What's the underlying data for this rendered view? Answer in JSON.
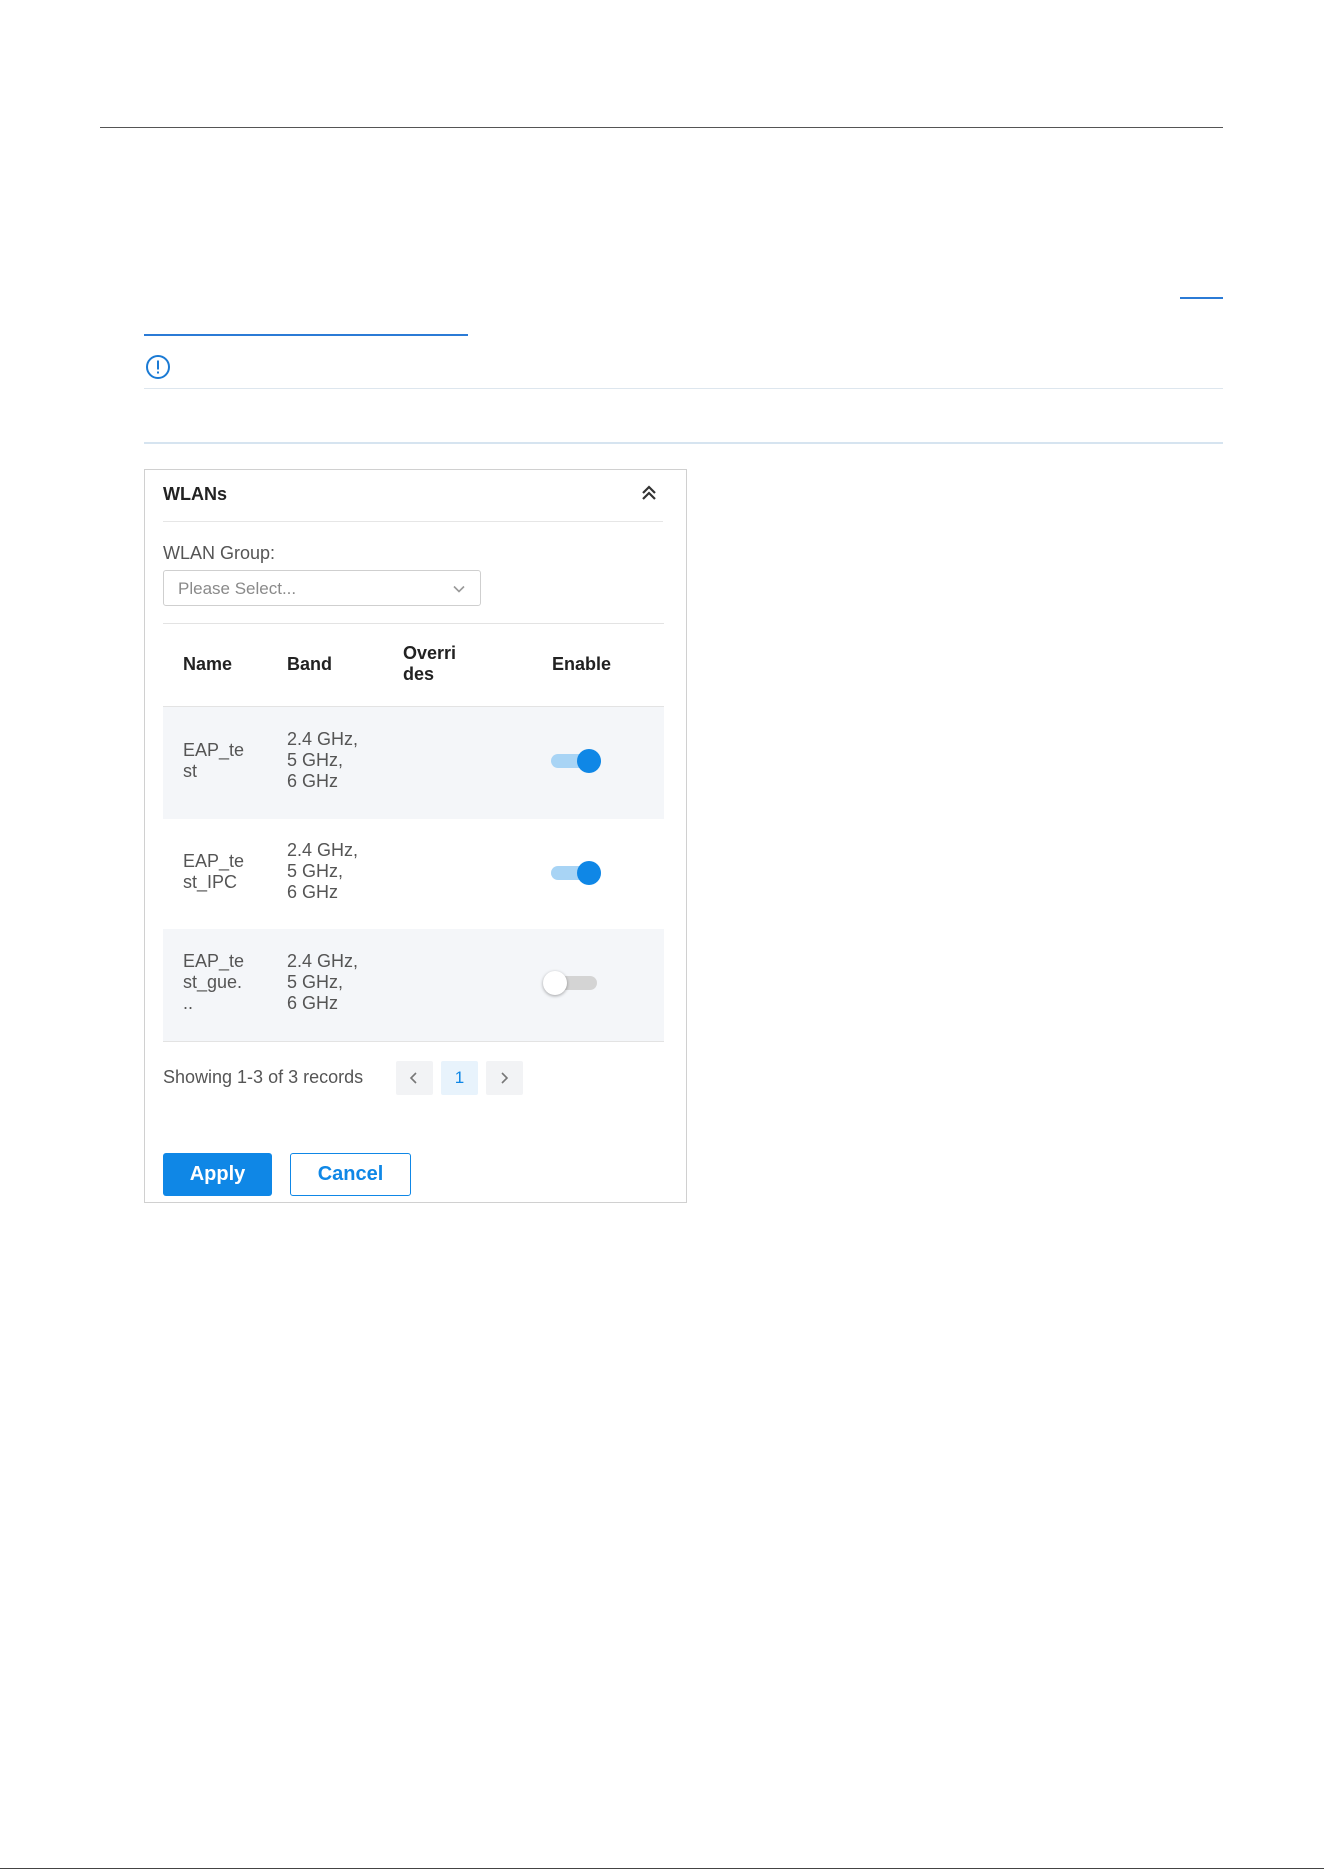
{
  "panel": {
    "title": "WLANs",
    "group_label": "WLAN Group:",
    "group_select": {
      "placeholder": "Please Select..."
    }
  },
  "table": {
    "columns": [
      "Name",
      "Band",
      "Overri\ndes",
      "Enable"
    ],
    "rows": [
      {
        "name": "EAP_te\nst",
        "band": "2.4 GHz,\n5 GHz,\n6 GHz",
        "overrides": "",
        "enabled": true
      },
      {
        "name": "EAP_te\nst_IPC",
        "band": "2.4 GHz,\n5 GHz,\n6 GHz",
        "overrides": "",
        "enabled": true
      },
      {
        "name": "EAP_te\nst_gue.\n..",
        "band": "2.4 GHz,\n5 GHz,\n6 GHz",
        "overrides": "",
        "enabled": false
      }
    ]
  },
  "pagination": {
    "summary": "Showing 1-3 of 3 records",
    "current_page": "1"
  },
  "buttons": {
    "apply": "Apply",
    "cancel": "Cancel"
  },
  "colors": {
    "accent": "#0f87e6",
    "toggle_track_on": "#a8d4f5",
    "toggle_track_off": "#d4d4d4",
    "row_stripe": "#f4f6f9"
  },
  "icons": [
    "info-icon",
    "double-chevron-up-icon",
    "chevron-down-icon",
    "chevron-left-icon",
    "chevron-right-icon"
  ]
}
